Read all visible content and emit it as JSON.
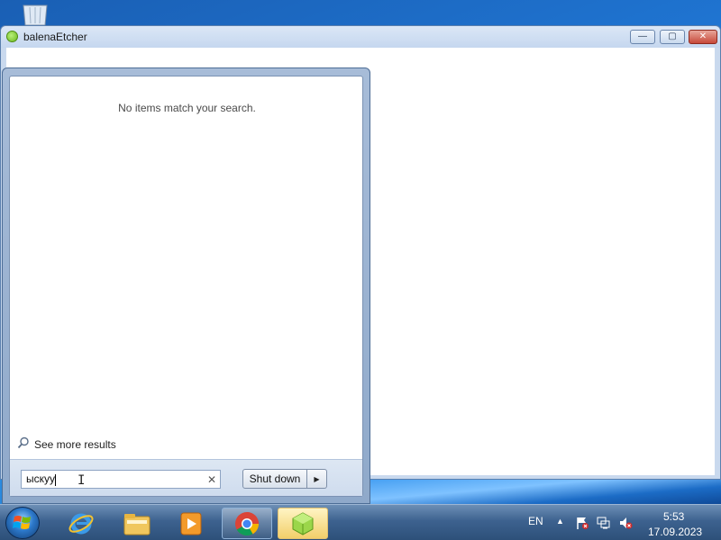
{
  "window": {
    "title": "balenaEtcher",
    "controls": {
      "minimize": "—",
      "maximize": "▢",
      "close": "✕"
    }
  },
  "start_menu": {
    "no_results_text": "No items match your search.",
    "see_more_label": "See more results",
    "search": {
      "value": "ыскуу",
      "clear_icon": "✕"
    },
    "shutdown_label": "Shut down",
    "shutdown_arrow": "▶"
  },
  "taskbar": {
    "items": [
      "start-orb",
      "internet-explorer-icon",
      "file-explorer-icon",
      "media-player-icon",
      "chrome-icon",
      "balena-etcher-icon"
    ],
    "language": "EN",
    "show_hidden_arrow": "▲",
    "clock": {
      "time": "5:53",
      "date": "17.09.2023"
    }
  }
}
